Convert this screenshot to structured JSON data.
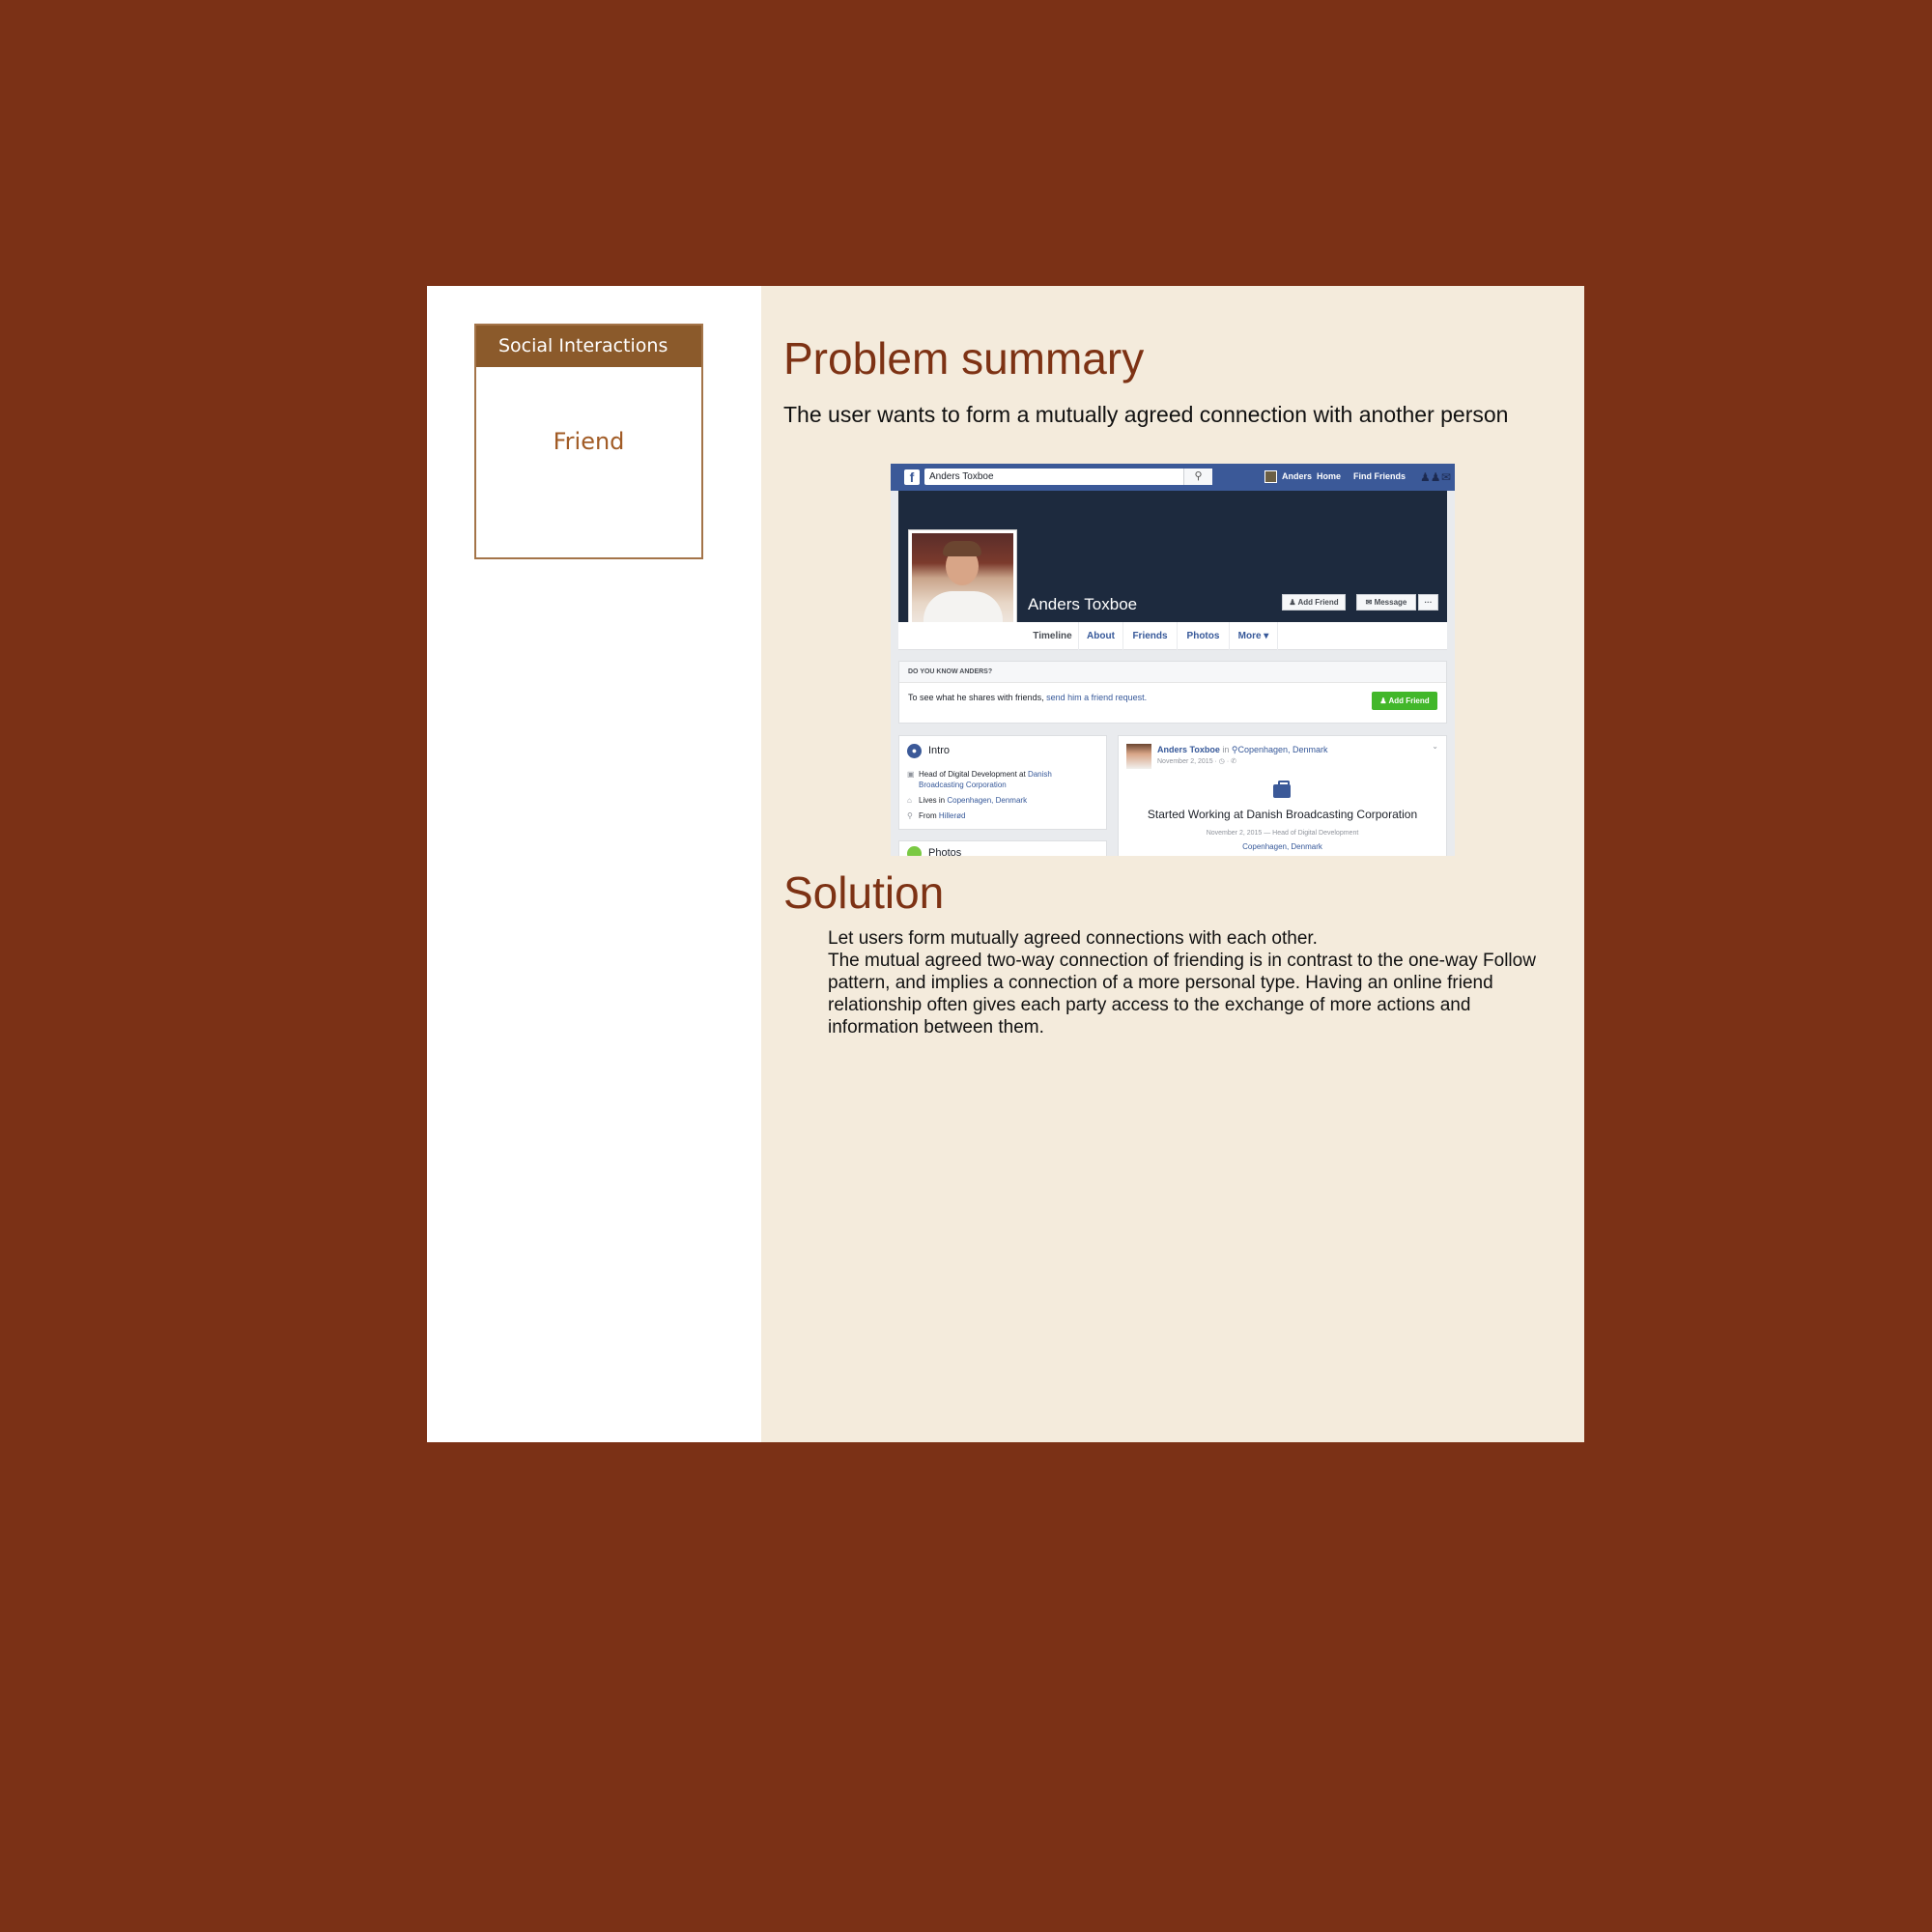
{
  "sidebar": {
    "category": "Social Interactions",
    "pattern": "Friend"
  },
  "problem": {
    "heading": "Problem summary",
    "text": "The user wants to form a mutually agreed connection with another person"
  },
  "solution": {
    "heading": "Solution",
    "line1": "Let users form mutually agreed connections with each other.",
    "line2": "The mutual agreed two-way connection of friending is in contrast to the one-way Follow pattern, and implies a connection of a more personal type. Having an online friend relationship often gives each party access to the exchange of more actions and information between them."
  },
  "screenshot": {
    "topbar": {
      "logo": "f",
      "search_value": "Anders Toxboe",
      "search_icon": "search-icon",
      "user": "Anders",
      "home": "Home",
      "find_friends": "Find Friends"
    },
    "profile": {
      "name": "Anders Toxboe",
      "add_friend": "Add Friend",
      "message": "Message",
      "more_dots": "···"
    },
    "tabs": [
      "Timeline",
      "About",
      "Friends",
      "Photos",
      "More ▾"
    ],
    "know": {
      "heading": "DO YOU KNOW ANDERS?",
      "text": "To see what he shares with friends, ",
      "link": "send him a friend request.",
      "button": "Add Friend"
    },
    "intro": {
      "title": "Intro",
      "work_prefix": "Head of Digital Development at ",
      "work_link_1": "Danish",
      "work_link_2": "Broadcasting Corporation",
      "lives_prefix": "Lives in ",
      "lives_link": "Copenhagen, Denmark",
      "from_prefix": "From ",
      "from_link": "Hillerød",
      "photos_title": "Photos"
    },
    "post": {
      "author": "Anders Toxboe",
      "in_word": "in",
      "location": "Copenhagen, Denmark",
      "date": "November 2, 2015 · ◷ · ✆",
      "headline": "Started Working at Danish Broadcasting Corporation",
      "sub": "November 2, 2015 — Head of Digital Development",
      "sub_location": "Copenhagen, Denmark"
    }
  },
  "colors": {
    "background": "#7b3116",
    "panel": "#f4ebdc",
    "heading": "#7d3214",
    "category_header": "#8b5a2b",
    "facebook_blue": "#3b5998",
    "green": "#42b72a"
  }
}
